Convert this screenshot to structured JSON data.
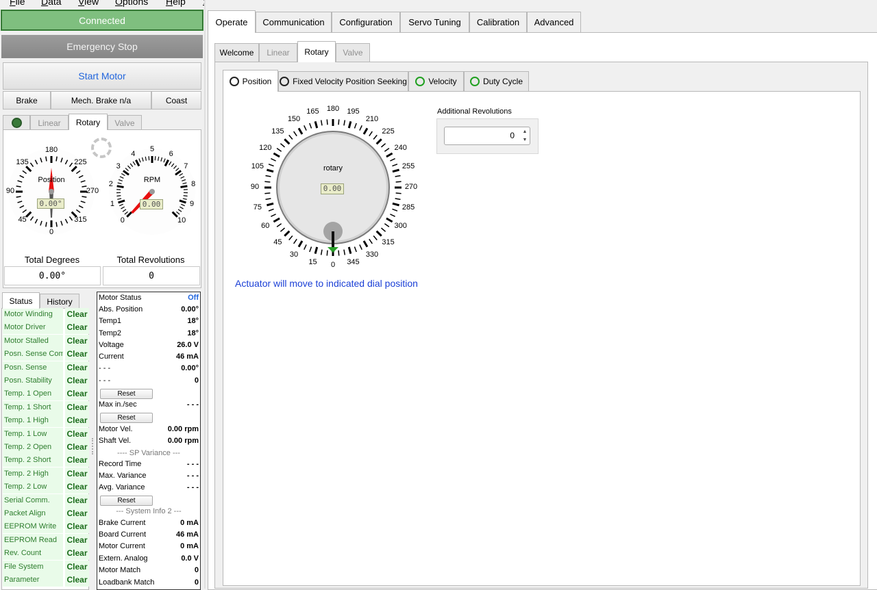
{
  "menu": [
    "File",
    "Data",
    "View",
    "Options",
    "Help"
  ],
  "left": {
    "connected": "Connected",
    "emergency_stop": "Emergency Stop",
    "start_motor": "Start Motor",
    "brake": "Brake",
    "mech_brake": "Mech. Brake n/a",
    "coast": "Coast",
    "tabs": [
      "Linear",
      "Rotary",
      "Valve"
    ],
    "position_gauge": {
      "title": "Position",
      "value": "0.00°",
      "ticks": [
        "0",
        "45",
        "90",
        "135",
        "180",
        "225",
        "270",
        "315"
      ]
    },
    "rpm_gauge": {
      "title": "RPM",
      "value": "0.00",
      "ticks": [
        "0",
        "1",
        "2",
        "3",
        "4",
        "5",
        "6",
        "7",
        "8",
        "9",
        "10"
      ]
    },
    "total_degrees_label": "Total Degrees",
    "total_degrees_value": "0.00°",
    "total_revs_label": "Total Revolutions",
    "total_revs_value": "0",
    "status_tabs": [
      "Status",
      "History"
    ],
    "status_rows": [
      {
        "name": "Motor Winding",
        "value": "Clear"
      },
      {
        "name": "Motor Driver",
        "value": "Clear"
      },
      {
        "name": "Motor Stalled",
        "value": "Clear"
      },
      {
        "name": "Posn. Sense Com",
        "value": "Clear"
      },
      {
        "name": "Posn. Sense",
        "value": "Clear"
      },
      {
        "name": "Posn. Stability",
        "value": "Clear"
      },
      {
        "name": "Temp. 1 Open",
        "value": "Clear"
      },
      {
        "name": "Temp. 1 Short",
        "value": "Clear"
      },
      {
        "name": "Temp. 1 High",
        "value": "Clear"
      },
      {
        "name": "Temp. 1 Low",
        "value": "Clear"
      },
      {
        "name": "Temp. 2 Open",
        "value": "Clear"
      },
      {
        "name": "Temp. 2 Short",
        "value": "Clear"
      },
      {
        "name": "Temp. 2 High",
        "value": "Clear"
      },
      {
        "name": "Temp. 2 Low",
        "value": "Clear"
      },
      {
        "name": "Serial Comm.",
        "value": "Clear"
      },
      {
        "name": "Packet Align",
        "value": "Clear"
      },
      {
        "name": "EEPROM Write",
        "value": "Clear"
      },
      {
        "name": "EEPROM Read",
        "value": "Clear"
      },
      {
        "name": "Rev. Count",
        "value": "Clear"
      },
      {
        "name": "File System",
        "value": "Clear"
      },
      {
        "name": "Parameter",
        "value": "Clear"
      }
    ],
    "info": {
      "motor_status": {
        "k": "Motor Status",
        "v": "Off"
      },
      "abs_position": {
        "k": "Abs. Position",
        "v": "0.00°"
      },
      "temp1": {
        "k": "Temp1",
        "v": "18°"
      },
      "temp2": {
        "k": "Temp2",
        "v": "18°"
      },
      "voltage": {
        "k": "Voltage",
        "v": "26.0 V"
      },
      "current": {
        "k": "Current",
        "v": "46 mA"
      },
      "dash1": {
        "k": "- - -",
        "v": "0.00°"
      },
      "dash2": {
        "k": "- - -",
        "v": "0"
      },
      "reset": "Reset",
      "max_in_sec": {
        "k": "Max in./sec",
        "v": "- - -"
      },
      "motor_vel": {
        "k": "Motor Vel.",
        "v": "0.00 rpm"
      },
      "shaft_vel": {
        "k": "Shaft Vel.",
        "v": "0.00 rpm"
      },
      "sp_variance": "---- SP Variance ---",
      "record_time": {
        "k": "Record Time",
        "v": "- - -"
      },
      "max_variance": {
        "k": "Max. Variance",
        "v": "- - -"
      },
      "avg_variance": {
        "k": "Avg. Variance",
        "v": "- - -"
      },
      "system_info2": "--- System Info 2 ---",
      "brake_current": {
        "k": "Brake Current",
        "v": "0 mA"
      },
      "board_current": {
        "k": "Board Current",
        "v": "46 mA"
      },
      "motor_current": {
        "k": "Motor Current",
        "v": "0 mA"
      },
      "extern_analog": {
        "k": "Extern. Analog",
        "v": "0.0 V"
      },
      "motor_match": {
        "k": "Motor Match",
        "v": "0"
      },
      "loadbank_match": {
        "k": "Loadbank Match",
        "v": "0"
      }
    }
  },
  "main": {
    "tabs": [
      "Operate",
      "Communication",
      "Configuration",
      "Servo Tuning",
      "Calibration",
      "Advanced"
    ],
    "sub_tabs": [
      "Welcome",
      "Linear",
      "Rotary",
      "Valve"
    ],
    "mode_tabs": [
      "Position",
      "Fixed Velocity Position Seeking",
      "Velocity",
      "Duty Cycle"
    ],
    "dial": {
      "title": "rotary",
      "value": "0.00",
      "ticks": [
        "0",
        "15",
        "30",
        "45",
        "60",
        "75",
        "90",
        "105",
        "120",
        "135",
        "150",
        "165",
        "180",
        "195",
        "210",
        "225",
        "240",
        "255",
        "270",
        "285",
        "300",
        "315",
        "330",
        "345"
      ]
    },
    "additional_revs_label": "Additional Revolutions",
    "additional_revs_value": "0",
    "hint": "Actuator will move to indicated dial position"
  },
  "colors": {
    "connected": "#7fbf7f",
    "status_green": "#2e7d2e",
    "hint_blue": "#1a3fd6"
  }
}
